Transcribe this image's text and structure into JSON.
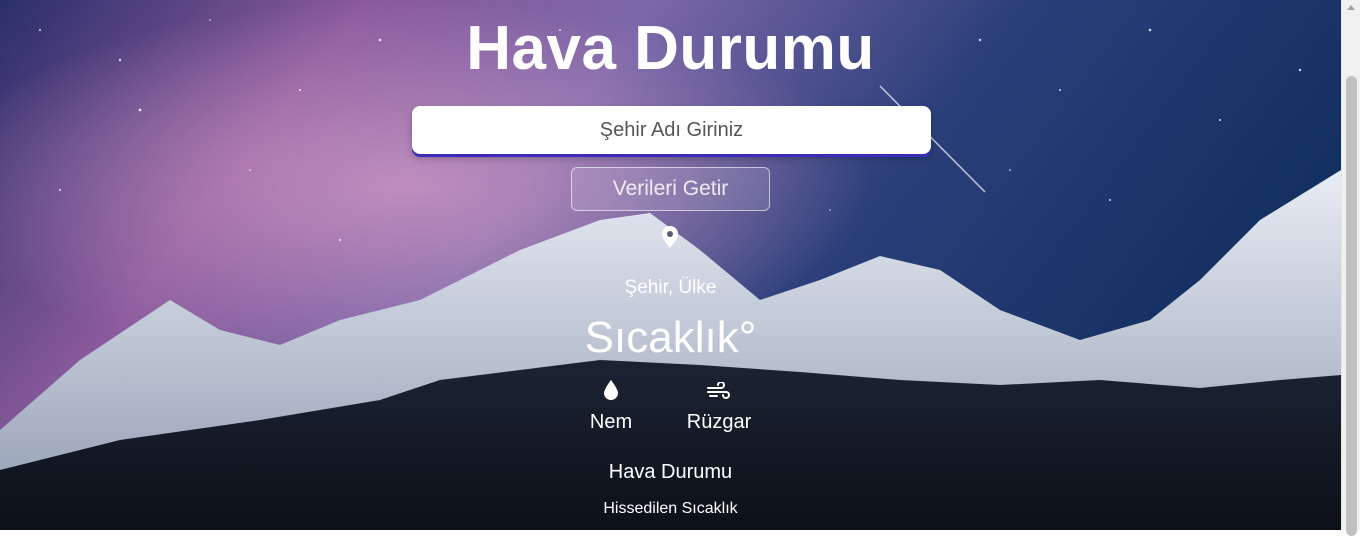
{
  "app": {
    "title": "Hava Durumu"
  },
  "search": {
    "placeholder": "Şehir Adı Giriniz",
    "value": ""
  },
  "fetch_button": {
    "label": "Verileri Getir"
  },
  "weather": {
    "location": "Şehir, Ülke",
    "temperature": "Sıcaklık°",
    "humidity_label": "Nem",
    "wind_label": "Rüzgar",
    "description": "Hava Durumu",
    "feels_like": "Hissedilen Sıcaklık"
  },
  "icons": {
    "location": "location-pin-icon",
    "humidity": "water-drop-icon",
    "wind": "wind-icon"
  },
  "colors": {
    "input_shadow": "#3b2bb8",
    "text": "#ffffff"
  }
}
